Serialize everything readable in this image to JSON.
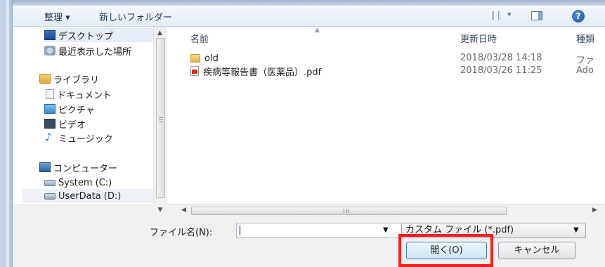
{
  "toolbar": {
    "organize_label": "整理 ▾",
    "new_folder_label": "新しいフォルダー",
    "view_dropdown": "▾",
    "help_symbol": "?"
  },
  "nav": {
    "items": [
      {
        "label": "デスクトップ",
        "icon": "desktop-icon"
      },
      {
        "label": "最近表示した場所",
        "icon": "recent-places-icon"
      },
      {
        "label": "ライブラリ",
        "icon": "library-icon"
      },
      {
        "label": "ドキュメント",
        "icon": "documents-icon"
      },
      {
        "label": "ピクチャ",
        "icon": "pictures-icon"
      },
      {
        "label": "ビデオ",
        "icon": "videos-icon"
      },
      {
        "label": "ミュージック",
        "icon": "music-icon"
      },
      {
        "label": "コンピューター",
        "icon": "computer-icon"
      },
      {
        "label": "System (C:)",
        "icon": "drive-icon"
      },
      {
        "label": "UserData (D:)",
        "icon": "drive-icon"
      }
    ]
  },
  "files": {
    "columns": {
      "name": "名前",
      "date": "更新日時",
      "type": "種類"
    },
    "rows": [
      {
        "name": "old",
        "date": "2018/03/28 14:18",
        "type": "ファ",
        "icon": "folder-icon"
      },
      {
        "name": "疾病等報告書（医薬品）.pdf",
        "date": "2018/03/26 11:25",
        "type": "Ado",
        "icon": "pdf-icon"
      }
    ]
  },
  "bottom": {
    "filename_label": "ファイル名(N):",
    "filename_value": "",
    "filter_value": "カスタム ファイル (*.pdf)",
    "open_label": "開く(O)",
    "cancel_label": "キャンセル"
  },
  "colors": {
    "highlight": "#ff1a1a",
    "toolbar_text": "#1e3a5f"
  }
}
